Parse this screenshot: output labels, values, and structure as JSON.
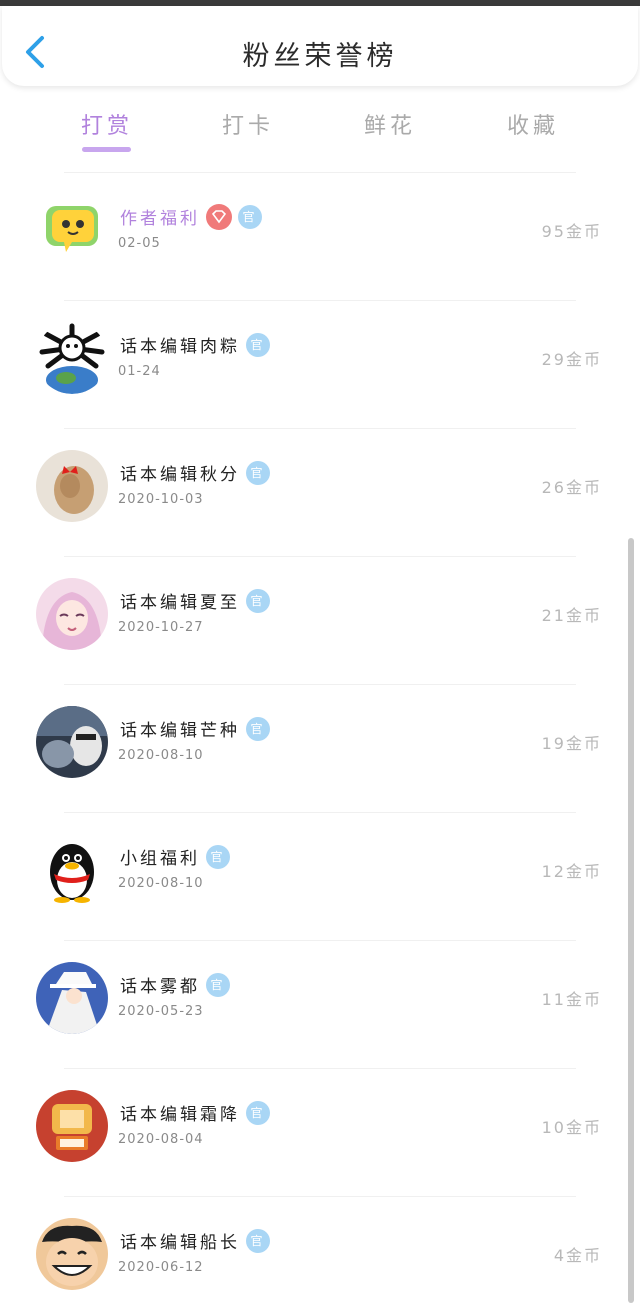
{
  "header": {
    "title": "粉丝荣誉榜"
  },
  "tabs": [
    {
      "label": "打赏",
      "active": true
    },
    {
      "label": "打卡",
      "active": false
    },
    {
      "label": "鲜花",
      "active": false
    },
    {
      "label": "收藏",
      "active": false
    }
  ],
  "rows": [
    {
      "name": "作者福利",
      "date": "02-05",
      "amount": "95金币",
      "name_color": "purple",
      "badges": [
        "diamond-icon",
        "official-icon"
      ],
      "avatar": "chat-bubble-sticker"
    },
    {
      "name": "话本编辑肉粽",
      "date": "01-24",
      "amount": "29金币",
      "badges": [
        "official-icon"
      ],
      "avatar": "creature-globe"
    },
    {
      "name": "话本编辑秋分",
      "date": "2020-10-03",
      "amount": "26金币",
      "badges": [
        "official-icon"
      ],
      "avatar": "girl-hair-bow"
    },
    {
      "name": "话本编辑夏至",
      "date": "2020-10-27",
      "amount": "21金币",
      "badges": [
        "official-icon"
      ],
      "avatar": "anime-girl-pink"
    },
    {
      "name": "话本编辑芒种",
      "date": "2020-08-10",
      "amount": "19金币",
      "badges": [
        "official-icon"
      ],
      "avatar": "car-driver"
    },
    {
      "name": "小组福利",
      "date": "2020-08-10",
      "amount": "12金币",
      "badges": [
        "official-icon"
      ],
      "avatar": "penguin"
    },
    {
      "name": "话本雾都",
      "date": "2020-05-23",
      "amount": "11金币",
      "badges": [
        "official-icon"
      ],
      "avatar": "kaito-kid"
    },
    {
      "name": "话本编辑霜降",
      "date": "2020-08-04",
      "amount": "10金币",
      "badges": [
        "official-icon"
      ],
      "avatar": "cartoon-orange"
    },
    {
      "name": "话本编辑船长",
      "date": "2020-06-12",
      "amount": "4金币",
      "badges": [
        "official-icon"
      ],
      "avatar": "straw-hat-boy"
    }
  ],
  "official_badge_text": "官",
  "colors": {
    "accent": "#b182dd",
    "badge_blue": "#a9d6f5",
    "badge_red": "#f07a7a",
    "back_arrow": "#2ea0e8"
  }
}
